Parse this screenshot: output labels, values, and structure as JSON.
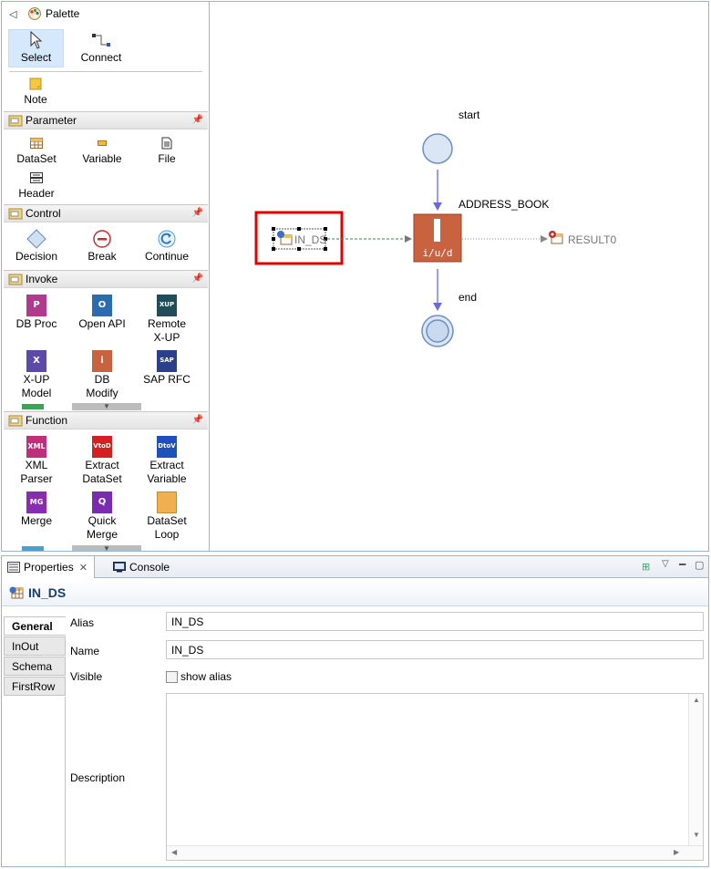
{
  "palette": {
    "title": "Palette",
    "tools": {
      "select": "Select",
      "connect": "Connect",
      "note": "Note"
    },
    "groups": [
      {
        "name": "Parameter",
        "items": [
          "DataSet",
          "Variable",
          "File",
          "Header"
        ]
      },
      {
        "name": "Control",
        "items": [
          "Decision",
          "Break",
          "Continue"
        ]
      },
      {
        "name": "Invoke",
        "items": [
          "DB Proc",
          "Open API",
          "Remote\nX-UP",
          "X-UP\nModel",
          "DB\nModify",
          "SAP RFC"
        ]
      },
      {
        "name": "Function",
        "items": [
          "XML\nParser",
          "Extract\nDataSet",
          "Extract\nVariable",
          "Merge",
          "Quick\nMerge",
          "DataSet\nLoop"
        ]
      }
    ],
    "icon_texts": {
      "xup": "XUP",
      "sap": "SAP",
      "xml": "XML",
      "vtod": "VtoD",
      "dtov": "DtoV",
      "mg": "MG"
    }
  },
  "canvas": {
    "start_label": "start",
    "end_label": "end",
    "node_label": "ADDRESS_BOOK",
    "node_text": "i/u/d",
    "input_label": "IN_DS",
    "output_label": "RESULT0"
  },
  "properties": {
    "tabs": [
      "Properties",
      "Console"
    ],
    "title": "IN_DS",
    "side_tabs": [
      "General",
      "InOut",
      "Schema",
      "FirstRow"
    ],
    "fields": {
      "alias_label": "Alias",
      "alias_value": "IN_DS",
      "name_label": "Name",
      "name_value": "IN_DS",
      "visible_label": "Visible",
      "show_alias": "show alias",
      "description_label": "Description"
    }
  },
  "colors": {
    "accent": "#2b5797",
    "node": "#c8623f",
    "highlight": "#e00000",
    "circle": "#c9d9ef"
  }
}
